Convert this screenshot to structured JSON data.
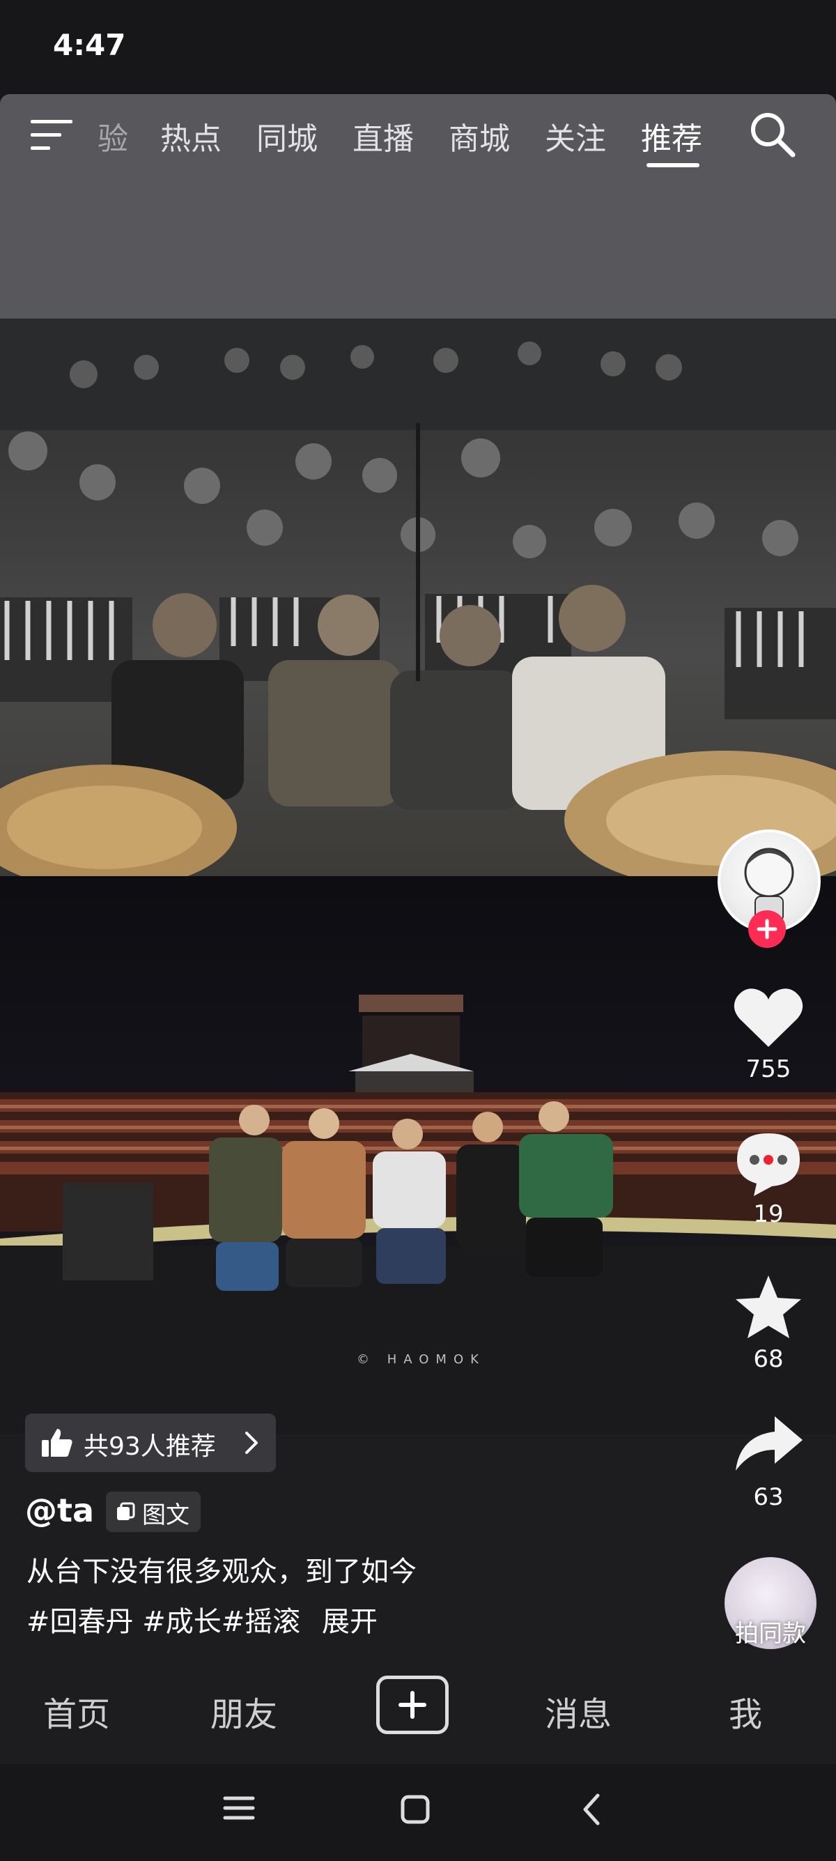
{
  "status_bar": {
    "time": "4:47"
  },
  "nav": {
    "tabs": [
      {
        "label": "验",
        "state": "partial"
      },
      {
        "label": "热点",
        "state": "normal"
      },
      {
        "label": "同城",
        "state": "normal"
      },
      {
        "label": "直播",
        "state": "normal"
      },
      {
        "label": "商城",
        "state": "normal"
      },
      {
        "label": "关注",
        "state": "normal"
      },
      {
        "label": "推荐",
        "state": "active"
      }
    ],
    "menu_icon": "menu-icon",
    "search_icon": "search-icon"
  },
  "post": {
    "watermark": "© HAOMOK",
    "recommend_label": "共93人推荐",
    "author": "@ta",
    "type_badge": "图文",
    "caption": "从台下没有很多观众，到了如今",
    "hashtags": "#回春丹 #成长#摇滚",
    "expand_label": "展开"
  },
  "actions": {
    "likes": "755",
    "comments": "19",
    "favorites": "68",
    "shares": "63",
    "sound_label": "拍同款"
  },
  "bottom_tabs": {
    "home": "首页",
    "friends": "朋友",
    "messages": "消息",
    "me": "我"
  },
  "colors": {
    "accent": "#fe2c55",
    "background": "#171719",
    "nav_overlay": "#58585c"
  }
}
